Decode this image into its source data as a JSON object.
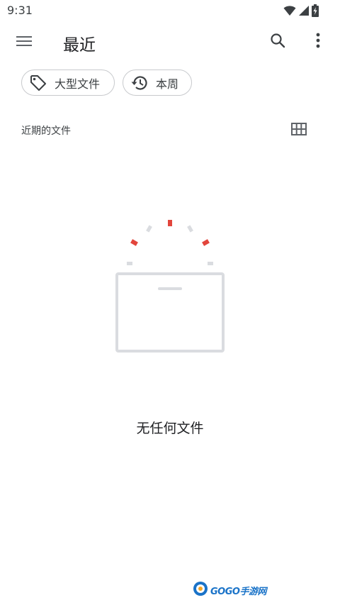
{
  "status_bar": {
    "time": "9:31",
    "icons": [
      "wifi-icon",
      "cellular-signal-icon",
      "battery-charging-icon"
    ]
  },
  "app_bar": {
    "menu_icon": "hamburger-menu-icon",
    "title": "最近",
    "search_icon": "search-icon",
    "more_icon": "more-vert-icon"
  },
  "filters": [
    {
      "label": "大型文件",
      "icon": "tag-icon"
    },
    {
      "label": "本周",
      "icon": "history-icon"
    }
  ],
  "section": {
    "label": "近期的文件",
    "view_toggle_icon": "grid-view-icon"
  },
  "empty_state": {
    "icon": "empty-folder-illustration",
    "message": "无任何文件"
  },
  "watermark": {
    "text": "GOGO手游网",
    "icon": "gogo-logo-icon"
  },
  "colors": {
    "accent_red": "#e2453c",
    "muted_gray": "#dadce0",
    "text_primary": "#202124",
    "chip_border": "#c8cacd"
  }
}
